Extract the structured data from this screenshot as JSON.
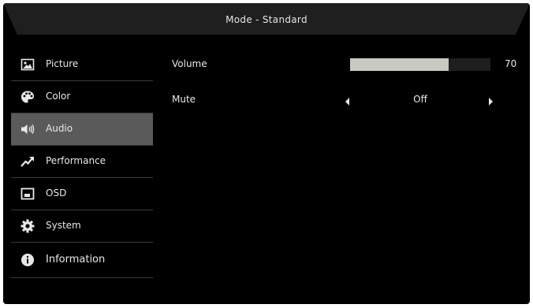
{
  "header": {
    "title": "Mode - Standard"
  },
  "sidebar": {
    "items": [
      {
        "label": "Picture",
        "icon": "picture-icon",
        "active": false
      },
      {
        "label": "Color",
        "icon": "palette-icon",
        "active": false
      },
      {
        "label": "Audio",
        "icon": "speaker-icon",
        "active": true
      },
      {
        "label": "Performance",
        "icon": "trend-arrow-icon",
        "active": false
      },
      {
        "label": "OSD",
        "icon": "osd-window-icon",
        "active": false
      },
      {
        "label": "System",
        "icon": "gear-icon",
        "active": false
      },
      {
        "label": "Information",
        "icon": "info-icon",
        "active": false
      }
    ]
  },
  "audio": {
    "volume": {
      "label": "Volume",
      "value": 70,
      "value_text": "70",
      "max": 100
    },
    "mute": {
      "label": "Mute",
      "value": "Off"
    }
  },
  "colors": {
    "background": "#000000",
    "active_item": "#5a5a5a",
    "volume_fill": "#c9c9c1",
    "text": "#e8e8e8"
  }
}
